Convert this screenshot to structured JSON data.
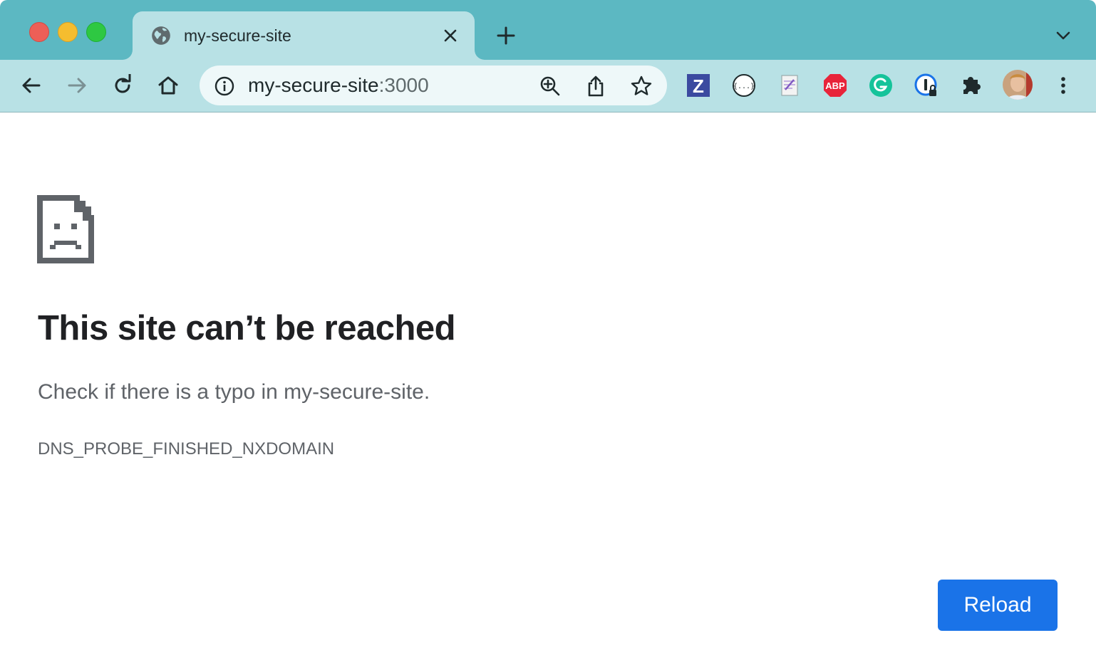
{
  "tab": {
    "title": "my-secure-site",
    "favicon": "globe-icon"
  },
  "omnibox": {
    "host": "my-secure-site",
    "port": ":3000"
  },
  "extensions": [
    "zotero-icon",
    "json-viewer-icon",
    "notes-icon",
    "adblock-plus-icon",
    "grammarly-icon",
    "password-manager-icon",
    "extensions-puzzle-icon",
    "profile-avatar"
  ],
  "extension_labels": {
    "zotero": "Z",
    "json": "{...}",
    "abp": "ABP"
  },
  "error": {
    "headline": "This site can’t be reached",
    "suggestion": "Check if there is a typo in my-secure-site.",
    "code": "DNS_PROBE_FINISHED_NXDOMAIN",
    "reload_label": "Reload"
  },
  "colors": {
    "tabstrip": "#5cb8c2",
    "toolbar": "#b8e1e5",
    "reload_button": "#1a73e8",
    "headline": "#202124",
    "secondary_text": "#5f6368"
  }
}
